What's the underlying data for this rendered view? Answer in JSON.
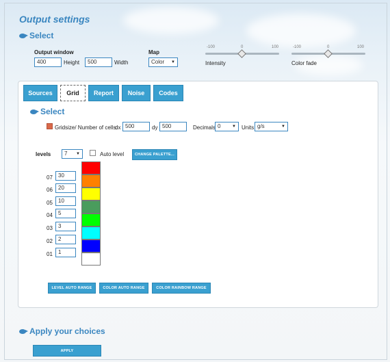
{
  "title": "Output settings",
  "select_label": "Select",
  "output_window": {
    "label": "Output window",
    "height_value": "400",
    "height_label": "Height",
    "width_value": "500",
    "width_label": "Width"
  },
  "map": {
    "label": "Map",
    "value": "Color"
  },
  "intensity": {
    "label": "Intensity",
    "min": "-100",
    "mid": "0",
    "max": "100",
    "value": 0
  },
  "color_fade": {
    "label": "Color fade",
    "min": "-100",
    "mid": "0",
    "max": "100",
    "value": 0
  },
  "tabs": [
    {
      "label": "Sources"
    },
    {
      "label": "Grid"
    },
    {
      "label": "Report"
    },
    {
      "label": "Noise"
    },
    {
      "label": "Codes"
    }
  ],
  "grid": {
    "select_label": "Select",
    "gridsize_label": "Gridsize/ Number of cells:",
    "dx_label": "dx",
    "dx_value": "500",
    "dy_label": "dy",
    "dy_value": "500",
    "decimals_label": "Decimals",
    "decimals_value": "0",
    "units_label": "Units",
    "units_value": "g/s",
    "levels_label": "levels",
    "levels_value": "7",
    "auto_level_label": "Auto level",
    "change_palette": "CHANGE PALETTE...",
    "rows": [
      {
        "id": "07",
        "value": "30",
        "color": "#ff0000"
      },
      {
        "id": "06",
        "value": "20",
        "color": "#ff8000"
      },
      {
        "id": "05",
        "value": "10",
        "color": "#ffff00"
      },
      {
        "id": "04",
        "value": "5",
        "color": "#4a9c5d"
      },
      {
        "id": "03",
        "value": "3",
        "color": "#00ff00"
      },
      {
        "id": "02",
        "value": "2",
        "color": "#00ffff"
      },
      {
        "id": "01",
        "value": "1",
        "color": "#0000ff"
      }
    ],
    "extra_swatch_color": "#ffffff",
    "level_auto_range": "LEVEL AUTO RANGE",
    "color_auto_range": "COLOR AUTO RANGE",
    "color_rainbow_range": "COLOR RAINBOW RANGE"
  },
  "apply_section": {
    "label": "Apply your choices",
    "button": "APPLY"
  },
  "colors": {
    "accent": "#3a86c0",
    "tab": "#3aa0d0"
  }
}
